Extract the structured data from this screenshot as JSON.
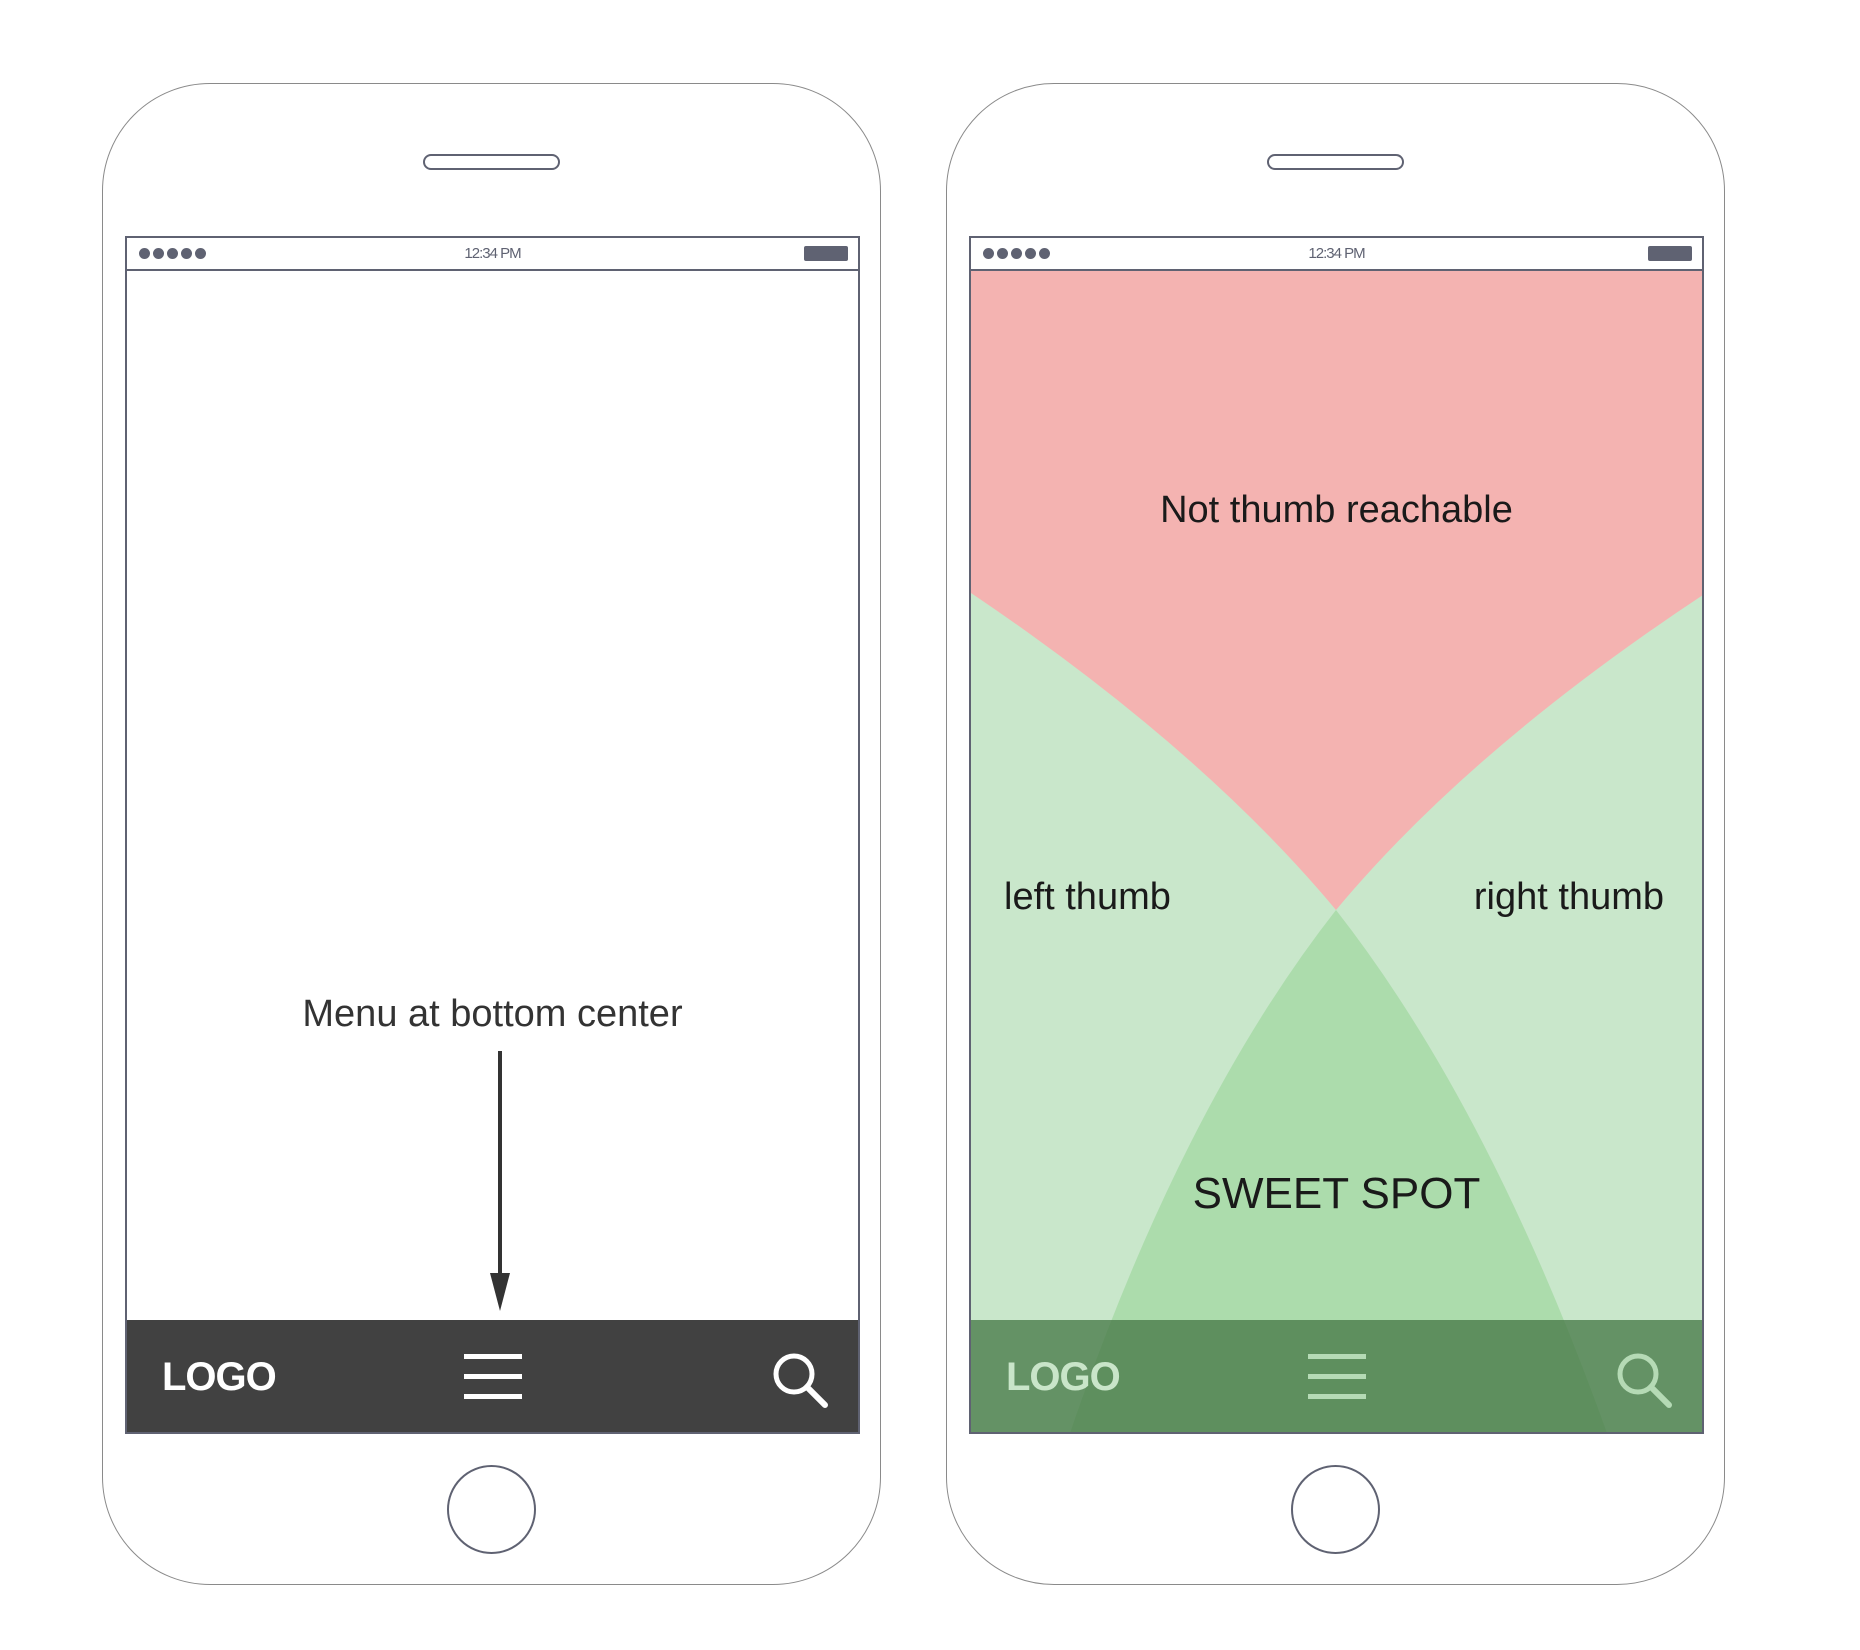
{
  "status_bar": {
    "time": "12:34 PM"
  },
  "left_phone": {
    "annotation": "Menu at bottom center",
    "menu_bar": {
      "logo": "LOGO",
      "menu_icon": "hamburger-menu-icon",
      "search_icon": "search-icon"
    }
  },
  "right_phone": {
    "zones": {
      "not_reachable": "Not thumb reachable",
      "left_thumb": "left thumb",
      "right_thumb": "right thumb",
      "sweet_spot": "SWEET SPOT"
    },
    "menu_bar": {
      "logo": "LOGO",
      "menu_icon": "hamburger-menu-icon",
      "search_icon": "search-icon"
    }
  },
  "colors": {
    "not_reachable": "#f4b3b1",
    "thumb_zone": "#c9e7cb",
    "sweet_spot": "#acdcac",
    "menu_bar_dark": "#414141",
    "menu_bar_green": "#6a9a6a",
    "outline": "#5f6272"
  }
}
